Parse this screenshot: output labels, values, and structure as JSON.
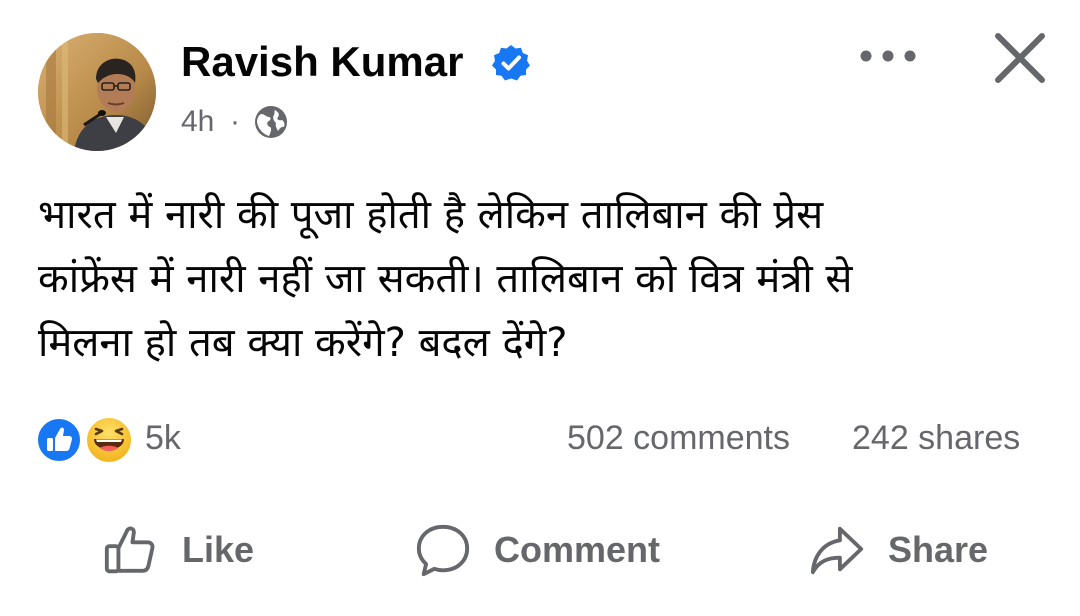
{
  "post": {
    "author": "Ravish Kumar",
    "verified": true,
    "time": "4h",
    "separator": "·",
    "audience_icon": "globe-icon",
    "text": "भारत में नारी की पूजा होती है लेकिन तालिबान की प्रेस\nकांफ्रेंस में नारी नहीं जा सकती। तालिबान को वित्र मंत्री से\nमिलना हो तब क्या करेंगे? बदल देंगे?"
  },
  "stats": {
    "reaction_icons": [
      "like-reaction-icon",
      "haha-reaction-icon"
    ],
    "reaction_count": "5k",
    "comments": "502 comments",
    "shares": "242 shares"
  },
  "actions": {
    "like": "Like",
    "comment": "Comment",
    "share": "Share"
  },
  "colors": {
    "text_primary": "#050505",
    "text_secondary": "#65676b",
    "facebook_blue": "#1877f2",
    "haha_yellow": "#f7c31b"
  }
}
